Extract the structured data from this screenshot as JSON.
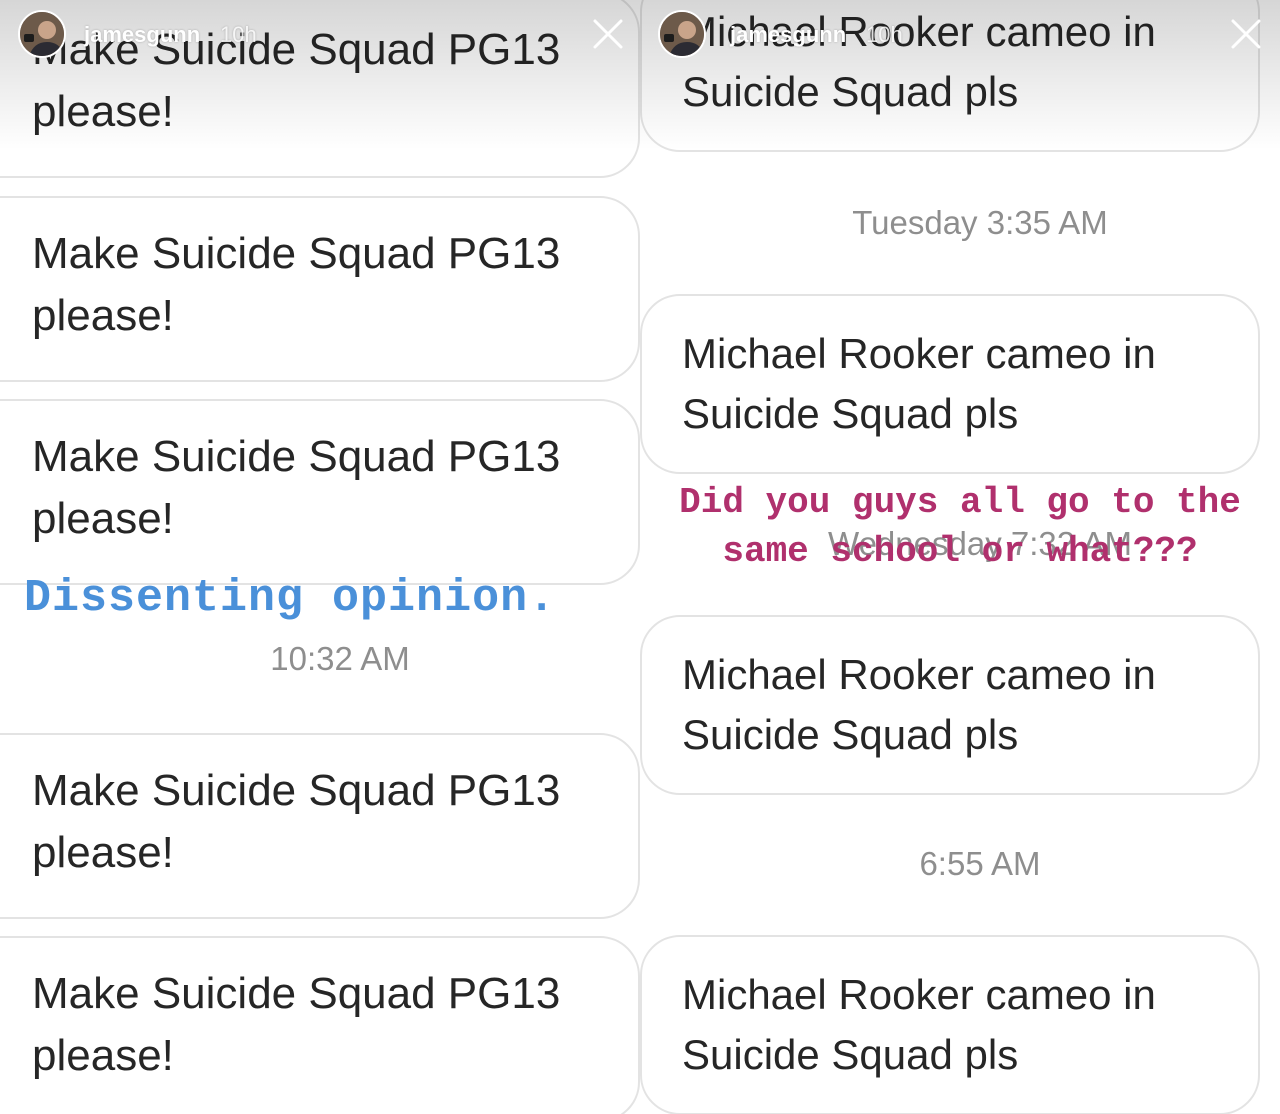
{
  "left_story": {
    "username": "jamesgunn",
    "time_ago": "10h",
    "caption": "Dissenting opinion.",
    "messages": [
      {
        "line1": "Make Suicide Squad PG13",
        "line2": "please!"
      },
      {
        "line1": "Make Suicide Squad PG13",
        "line2": "please!"
      },
      {
        "line1": "Make Suicide Squad PG13",
        "line2": "please!"
      },
      {
        "line1": "Make Suicide Squad PG13",
        "line2": "please!"
      },
      {
        "line1": "Make Suicide Squad PG13",
        "line2": "please!"
      }
    ],
    "timestamp": "10:32 AM"
  },
  "right_story": {
    "username": "jamesgunn",
    "time_ago": "10h",
    "caption": "Did you guys all go to the same school or what???",
    "messages": [
      {
        "line1": "Michael Rooker cameo in",
        "line2": "Suicide Squad pls"
      },
      {
        "line1": "Michael Rooker cameo in",
        "line2": "Suicide Squad pls"
      },
      {
        "line1": "Michael Rooker cameo in",
        "line2": "Suicide Squad pls"
      },
      {
        "line1": "Michael Rooker cameo in",
        "line2": "Suicide Squad pls"
      }
    ],
    "timestamps": [
      "Tuesday 3:35 AM",
      "Wednesday 7:32 AM",
      "6:55 AM"
    ]
  },
  "colors": {
    "left_caption": "#4a90d9",
    "right_caption": "#b0306d",
    "bubble_border": "#e3e3e3",
    "message_text": "#262626",
    "timestamp_text": "#8e8e8e"
  },
  "icons": {
    "avatar": "profile-photo",
    "close": "close-x-icon"
  }
}
